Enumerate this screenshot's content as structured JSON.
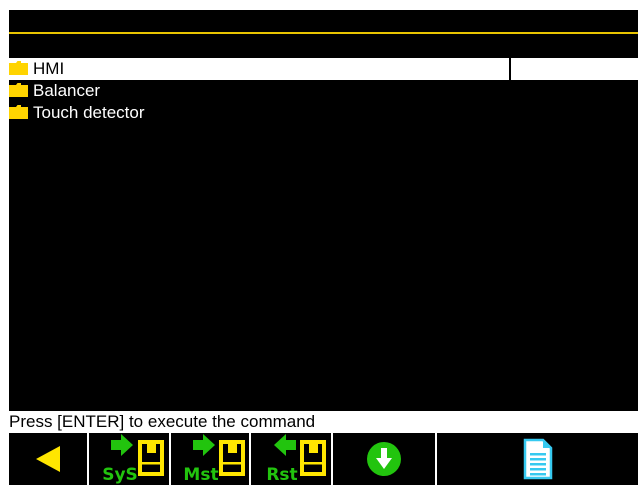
{
  "list": {
    "items": [
      {
        "label": "HMI",
        "selected": true,
        "icon": "folder-icon"
      },
      {
        "label": "Balancer",
        "selected": false,
        "icon": "folder-icon"
      },
      {
        "label": "Touch detector",
        "selected": false,
        "icon": "folder-icon"
      }
    ]
  },
  "status": {
    "text": "Press [ENTER] to execute the command"
  },
  "toolbar": {
    "buttons": [
      {
        "name": "back",
        "icon": "arrow-left-icon"
      },
      {
        "name": "save-system",
        "icon": "save-sys-icon",
        "label": "SyS"
      },
      {
        "name": "save-master",
        "icon": "save-mst-icon",
        "label": "Mst"
      },
      {
        "name": "restore",
        "icon": "restore-icon",
        "label": "Rst"
      },
      {
        "name": "download",
        "icon": "download-icon"
      },
      {
        "name": "document",
        "icon": "document-icon"
      }
    ]
  },
  "colors": {
    "background": "#000000",
    "accent_line": "#e8c400",
    "folder": "#ffd400",
    "toolbar_green": "#22c40e",
    "icon_yellow": "#ffe600",
    "doc_cyan": "#36c9f0"
  }
}
